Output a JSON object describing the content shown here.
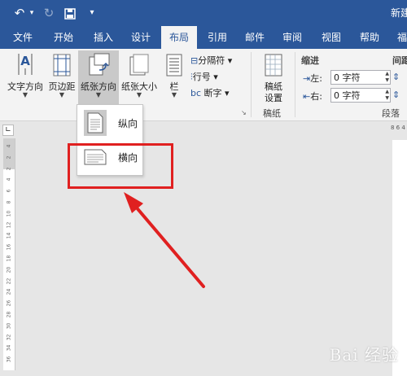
{
  "titlebar": {
    "title": "新建"
  },
  "tabs": [
    "文件",
    "开始",
    "插入",
    "设计",
    "布局",
    "引用",
    "邮件",
    "审阅",
    "视图",
    "帮助",
    "福"
  ],
  "active_tab": "布局",
  "ribbon": {
    "text_direction": "文字方向",
    "margins": "页边距",
    "orientation": "纸张方向",
    "size": "纸张大小",
    "columns": "栏",
    "breaks": "分隔符",
    "line_numbers": "行号",
    "hyphenation": "断字",
    "manuscript_btn_line1": "稿纸",
    "manuscript_btn_line2": "设置",
    "manuscript_group": "稿纸",
    "indent_group": "缩进",
    "indent_left_label": "左:",
    "indent_left_value": "0 字符",
    "indent_right_label": "右:",
    "indent_right_value": "0 字符",
    "spacing_group": "间距",
    "paragraph_group": "段落"
  },
  "dropdown": {
    "portrait": "纵向",
    "landscape": "横向",
    "selected": "纵向"
  },
  "ruler": {
    "vertical_labels": [
      "4",
      "2",
      "2",
      "4",
      "6",
      "8",
      "10",
      "12",
      "14",
      "16",
      "18",
      "20",
      "22",
      "24",
      "26",
      "28",
      "30",
      "32",
      "34",
      "36"
    ],
    "horizontal_label": "8 6 4"
  },
  "annotation": {
    "color": "#e02020"
  },
  "watermark": "Bai 经验"
}
